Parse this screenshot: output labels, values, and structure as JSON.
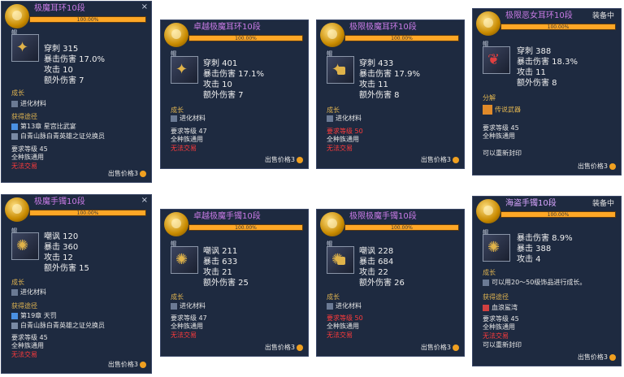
{
  "common": {
    "bar_text": "100.00%",
    "close": "×",
    "tag": "帽",
    "growth_label": "成长",
    "growth_item": "进化材料",
    "obtain_label": "获得途径",
    "req_level_45": "要求等级 45",
    "req_level_47": "要求等级 47",
    "req_level_50": "要求等级 50",
    "all_class": "全种族通用",
    "no_trade": "无法交易",
    "sell_price": "出售价格3",
    "equipped": "装备中",
    "decompose": "分解",
    "legend_weapon": "传说武器",
    "re_seal": "可以重新封印"
  },
  "colors": {
    "title_purple": "#c97be6",
    "bar_orange": "#ffa726",
    "panel_bg": "#1e2a40",
    "gold": "#e0b450",
    "red": "#ff3b3b"
  },
  "panels": [
    {
      "title": "极魔耳环10段",
      "stats": [
        "穿刺 315",
        "暴击伤害 17.0%",
        "攻击 10",
        "额外伤害 7"
      ],
      "obtain": [
        "第13章 星宫比武宴",
        "白青山脉白青英雄之证兑换员"
      ]
    },
    {
      "title": "卓越极魔耳环10段",
      "stats": [
        "穿刺 401",
        "暴击伤害 17.1%",
        "攻击 10",
        "额外伤害 7"
      ]
    },
    {
      "title": "极限极魔耳环10段",
      "stats": [
        "穿刺 433",
        "暴击伤害 17.9%",
        "攻击 11",
        "额外伤害 8"
      ]
    },
    {
      "title": "极限恶女耳环10段",
      "stats": [
        "穿刺 388",
        "暴击伤害 18.3%",
        "攻击 11",
        "额外伤害 8"
      ]
    },
    {
      "title": "极魔手镯10段",
      "stats": [
        "嘲讽 120",
        "暴击 360",
        "攻击 12",
        "额外伤害 15"
      ],
      "obtain": [
        "第19章 天罚",
        "白青山脉白青英雄之证兑换员"
      ]
    },
    {
      "title": "卓越极魔手镯10段",
      "stats": [
        "嘲讽 211",
        "暴击 633",
        "攻击 21",
        "额外伤害 25"
      ]
    },
    {
      "title": "极限极魔手镯10段",
      "stats": [
        "嘲讽 228",
        "暴击 684",
        "攻击 22",
        "额外伤害 26"
      ]
    },
    {
      "title": "海盗手镯10段",
      "stats": [
        "暴击伤害 8.9%",
        "暴击 388",
        "攻击 4"
      ],
      "growth_text": "可以用20～50级饰品进行成长。",
      "obtain": [
        "血浪鲨湾"
      ]
    }
  ]
}
